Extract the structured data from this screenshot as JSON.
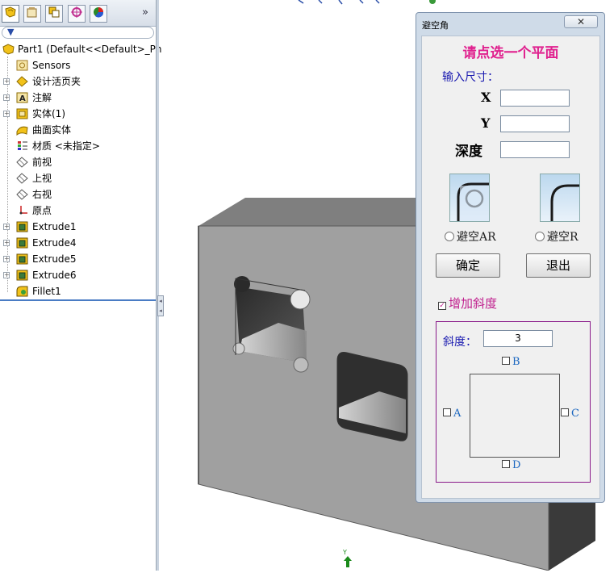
{
  "feature_tree": {
    "tabs": [
      "feature-manager",
      "property-manager",
      "configuration-manager",
      "dimxpert-manager",
      "display-manager"
    ],
    "filter_icon": "filter-icon",
    "root": "Part1  (Default<<Default>_Ph",
    "items": [
      {
        "label": "Sensors",
        "expandable": false,
        "icon": "sensor-icon"
      },
      {
        "label": "设计活页夹",
        "expandable": true,
        "icon": "design-binder-icon"
      },
      {
        "label": "注解",
        "expandable": true,
        "icon": "annotation-icon"
      },
      {
        "label": "实体(1)",
        "expandable": true,
        "icon": "solid-bodies-icon"
      },
      {
        "label": "曲面实体",
        "expandable": false,
        "icon": "surface-bodies-icon"
      },
      {
        "label": "材质 <未指定>",
        "expandable": false,
        "icon": "material-icon"
      },
      {
        "label": "前视",
        "expandable": false,
        "icon": "plane-icon"
      },
      {
        "label": "上视",
        "expandable": false,
        "icon": "plane-icon"
      },
      {
        "label": "右视",
        "expandable": false,
        "icon": "plane-icon"
      },
      {
        "label": "原点",
        "expandable": false,
        "icon": "origin-icon"
      },
      {
        "label": "Extrude1",
        "expandable": true,
        "icon": "extrude-icon"
      },
      {
        "label": "Extrude4",
        "expandable": true,
        "icon": "extrude-icon"
      },
      {
        "label": "Extrude5",
        "expandable": true,
        "icon": "extrude-icon"
      },
      {
        "label": "Extrude6",
        "expandable": true,
        "icon": "extrude-icon"
      },
      {
        "label": "Fillet1",
        "expandable": false,
        "icon": "fillet-icon"
      }
    ]
  },
  "dialog": {
    "title": "避空角",
    "close": "✕",
    "heading": "请点选一个平面",
    "input_label": "输入尺寸：",
    "fields": [
      {
        "label": "X",
        "value": ""
      },
      {
        "label": "Y",
        "value": ""
      },
      {
        "label": "深度",
        "value": ""
      }
    ],
    "options": [
      {
        "label": "避空AR",
        "icon": "corner-relief-ar-icon",
        "selected": false
      },
      {
        "label": "避空R",
        "icon": "corner-relief-r-icon",
        "selected": false
      }
    ],
    "ok_label": "确定",
    "exit_label": "退出",
    "slope_check_label": "增加斜度",
    "slope_checked": true,
    "slope_label": "斜度：",
    "slope_value": "3",
    "sides": {
      "top": "B",
      "left": "A",
      "right": "C",
      "bottom": "D"
    }
  },
  "viewport": {
    "axis_label": "Y",
    "colors": {
      "face_front": "#a0a0a0",
      "face_top": "#7f7f7f",
      "face_dark": "#3a3a3a",
      "accent_pink": "#e0208e"
    }
  }
}
